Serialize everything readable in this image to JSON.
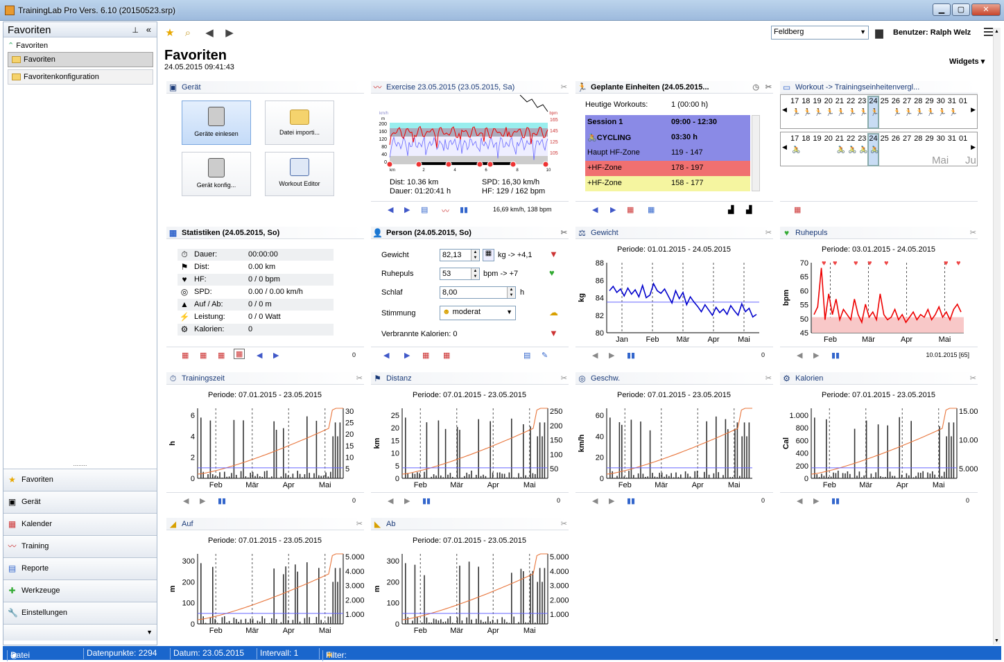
{
  "window": {
    "title": "TrainingLab Pro Vers. 6.10 (20150523.srp)"
  },
  "left": {
    "header": "Favoriten",
    "tree_root": "Favoriten",
    "tree_items": [
      "Favoriten",
      "Favoritenkonfiguration"
    ],
    "nav": [
      "Favoriten",
      "Gerät",
      "Kalender",
      "Training",
      "Reporte",
      "Werkzeuge",
      "Einstellungen"
    ]
  },
  "toolbar": {
    "location": "Feldberg",
    "user": "Benutzer: Ralph Welz"
  },
  "page": {
    "title": "Favoriten",
    "date": "24.05.2015 09:41:43",
    "widgets_label": "Widgets"
  },
  "geraet": {
    "title": "Gerät",
    "tiles": [
      "Geräte einlesen",
      "Datei importi...",
      "Gerät konfig...",
      "Workout Editor"
    ]
  },
  "exercise": {
    "title": "Exercise 23.05.2015 (23.05.2015, Sa)",
    "dist": "Dist: 10.36 km",
    "spd": "SPD: 16,30 km/h",
    "dauer": "Dauer: 01:20:41 h",
    "hf": "HF: 129 / 162 bpm",
    "footer": "16,69 km/h, 138 bpm",
    "yl_left": [
      "200",
      "160",
      "120",
      "80",
      "40",
      "0"
    ],
    "yl_right": [
      "165",
      "145",
      "125",
      "105"
    ],
    "unit_left": "km/h",
    "unit_left2": "m",
    "unit_right": "bpm",
    "xt": [
      "km",
      "2",
      "4",
      "6",
      "8",
      "10"
    ]
  },
  "geplant": {
    "title": "Geplante Einheiten (24.05.2015...",
    "heutige_label": "Heutige Workouts:",
    "heutige_value": "1 (00:00 h)",
    "rows": [
      {
        "a": "Session 1",
        "b": "09:00 - 12:30"
      },
      {
        "a": "CYCLING",
        "b": "03:30 h"
      },
      {
        "a": "Haupt HF-Zone",
        "b": "119 - 147"
      },
      {
        "a": "+HF-Zone",
        "b": "178 - 197"
      },
      {
        "a": "+HF-Zone",
        "b": "158 - 177"
      }
    ]
  },
  "workout": {
    "title": "Workout -> Trainingseinheitenvergl...",
    "days": [
      "17",
      "18",
      "19",
      "20",
      "21",
      "22",
      "23",
      "24",
      "25",
      "26",
      "27",
      "28",
      "29",
      "30",
      "31",
      "01"
    ],
    "month": "Mai",
    "month2": "Ju"
  },
  "statistik": {
    "title": "Statistiken (24.05.2015, So)",
    "footer_n": "0",
    "rows": [
      {
        "k": "Dauer:",
        "v": "00:00:00",
        "i": "⏱"
      },
      {
        "k": "Dist:",
        "v": "0.00 km",
        "i": "⚑"
      },
      {
        "k": "HF:",
        "v": "0 / 0 bpm",
        "i": "♥"
      },
      {
        "k": "SPD:",
        "v": "0.00 / 0.00 km/h",
        "i": "◎"
      },
      {
        "k": "Auf / Ab:",
        "v": "0 / 0 m",
        "i": "▲"
      },
      {
        "k": "Leistung:",
        "v": "0 / 0 Watt",
        "i": "⚡"
      },
      {
        "k": "Kalorien:",
        "v": "0",
        "i": "⚙"
      }
    ]
  },
  "person": {
    "title": "Person (24.05.2015, So)",
    "gewicht_label": "Gewicht",
    "gewicht": "82,13",
    "gewicht_unit": "kg -> +4,1",
    "ruhepuls_label": "Ruhepuls",
    "ruhepuls": "53",
    "ruhepuls_unit": "bpm  -> +7",
    "schlaf_label": "Schlaf",
    "schlaf": "8,00",
    "schlaf_unit": "h",
    "stimmung_label": "Stimmung",
    "stimmung": "moderat",
    "kalorien": "Verbrannte Kalorien: 0"
  },
  "chart_data": [
    {
      "type": "line",
      "id": "gewicht",
      "title": "Gewicht",
      "periode": "Periode: 01.01.2015 - 24.05.2015",
      "ylabel": "kg",
      "ylim": [
        80,
        88
      ],
      "yticks": [
        "88",
        "86",
        "84",
        "82",
        "80"
      ],
      "xticks": [
        "Jan",
        "Feb",
        "Mär",
        "Apr",
        "Mai"
      ],
      "footer": "0",
      "series": [
        {
          "values": [
            84.8,
            85.3,
            84.6,
            85.0,
            84.2,
            85.1,
            84.4,
            84.9,
            84.1,
            85.4,
            84.0,
            84.3,
            85.6,
            84.8,
            84.5,
            85.0,
            84.2,
            83.4,
            84.8,
            83.9,
            84.6,
            83.2,
            84.1,
            83.5,
            83.0,
            82.4,
            83.2,
            82.6,
            82.0,
            82.9,
            82.3,
            82.7,
            82.1,
            83.1,
            82.5,
            82.0,
            83.3,
            82.4,
            82.8,
            81.8,
            82.1
          ]
        }
      ],
      "avg": 83.5
    },
    {
      "type": "line",
      "id": "ruhepuls",
      "title": "Ruhepuls",
      "periode": "Periode: 03.01.2015 - 24.05.2015",
      "ylabel": "bpm",
      "ylim": [
        45,
        72
      ],
      "yticks": [
        "70",
        "65",
        "60",
        "55",
        "50",
        "45"
      ],
      "xticks": [
        "Feb",
        "Mär",
        "Apr",
        "Mai"
      ],
      "footer": "10.01.2015 [65]",
      "series": [
        {
          "values": [
            52,
            55,
            70,
            50,
            60,
            52,
            58,
            50,
            54,
            52,
            50,
            58,
            52,
            49,
            56,
            51,
            53,
            50,
            60,
            52,
            50,
            51,
            54,
            50,
            52,
            49,
            51,
            53,
            50,
            52,
            51,
            54,
            50,
            52,
            55,
            51,
            53,
            50,
            54,
            56,
            53
          ]
        }
      ]
    },
    {
      "type": "combo",
      "id": "trainingszeit",
      "title": "Trainingszeit",
      "periode": "Periode: 07.01.2015 - 23.05.2015",
      "ylabel": "h",
      "yticks": [
        "6",
        "4",
        "2",
        "0"
      ],
      "y2ticks": [
        "30",
        "25",
        "20",
        "15",
        "10",
        "5"
      ],
      "xticks": [
        "Feb",
        "Mär",
        "Apr",
        "Mai"
      ],
      "footer": "0"
    },
    {
      "type": "combo",
      "id": "distanz",
      "title": "Distanz",
      "periode": "Periode: 07.01.2015 - 23.05.2015",
      "ylabel": "km",
      "yticks": [
        "25",
        "20",
        "15",
        "10",
        "5",
        "0"
      ],
      "y2ticks": [
        "250",
        "200",
        "150",
        "100",
        "50"
      ],
      "xticks": [
        "Feb",
        "Mär",
        "Apr",
        "Mai"
      ],
      "footer": "0"
    },
    {
      "type": "combo",
      "id": "geschw",
      "title": "Geschw.",
      "periode": "Periode: 07.01.2015 - 23.05.2015",
      "ylabel": "km/h",
      "yticks": [
        "60",
        "40",
        "20",
        "0"
      ],
      "y2ticks": [],
      "xticks": [
        "Feb",
        "Mär",
        "Apr",
        "Mai"
      ],
      "footer": "0"
    },
    {
      "type": "combo",
      "id": "kalorien",
      "title": "Kalorien",
      "periode": "Periode: 07.01.2015 - 23.05.2015",
      "ylabel": "Cal",
      "yticks": [
        "1.000",
        "800",
        "600",
        "400",
        "200",
        "0"
      ],
      "y2ticks": [
        "15.000",
        "10.000",
        "5.000"
      ],
      "xticks": [
        "Feb",
        "Mär",
        "Apr",
        "Mai"
      ],
      "footer": "0"
    },
    {
      "type": "combo",
      "id": "auf",
      "title": "Auf",
      "periode": "Periode: 07.01.2015 - 23.05.2015",
      "ylabel": "m",
      "yticks": [
        "300",
        "200",
        "100",
        "0"
      ],
      "y2ticks": [
        "5.000",
        "4.000",
        "3.000",
        "2.000",
        "1.000"
      ],
      "xticks": [
        "Feb",
        "Mär",
        "Apr",
        "Mai"
      ],
      "footer": ""
    },
    {
      "type": "combo",
      "id": "ab",
      "title": "Ab",
      "periode": "Periode: 07.01.2015 - 23.05.2015",
      "ylabel": "m",
      "yticks": [
        "300",
        "200",
        "100",
        "0"
      ],
      "y2ticks": [
        "5.000",
        "4.000",
        "3.000",
        "2.000",
        "1.000"
      ],
      "xticks": [
        "Feb",
        "Mär",
        "Apr",
        "Mai"
      ],
      "footer": ""
    }
  ],
  "status": {
    "a": "Datei geladen",
    "b": "Datenpunkte: 2294",
    "c": "Datum: 23.05.2015",
    "d": "Intervall: 1",
    "e": "Filter: Keiner"
  }
}
